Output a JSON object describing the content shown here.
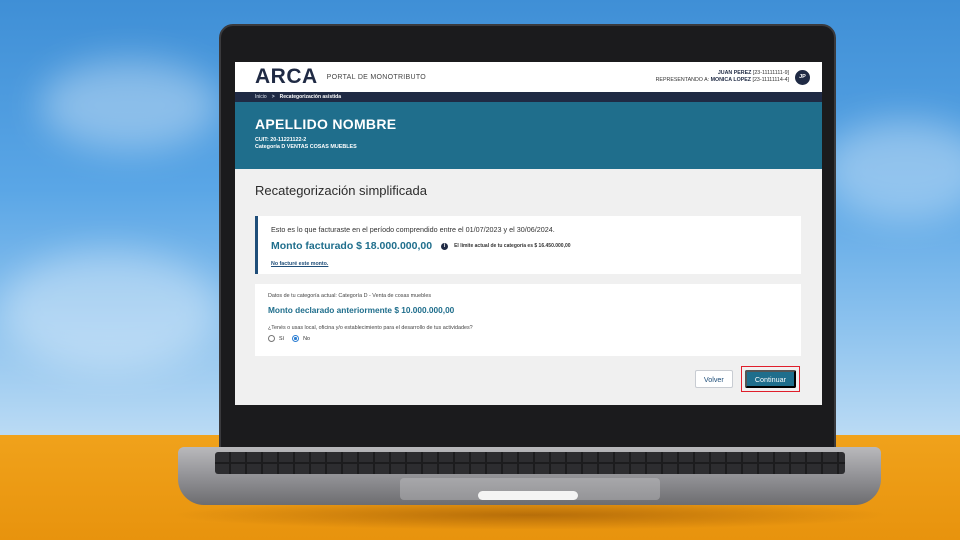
{
  "app": {
    "logo": "ARCA",
    "portal_name": "PORTAL DE MONOTRIBUTO"
  },
  "user": {
    "name": "JUAN PEREZ",
    "cuit": "[23-11111111-9]",
    "representing_label": "REPRESENTANDO A:",
    "represented_name": "MONICA LOPEZ",
    "represented_cuit": "[23-11111114-4]",
    "initials": "JP"
  },
  "breadcrumb": {
    "home": "Inicio",
    "separator": ">",
    "current": "Recategorización asistida"
  },
  "hero": {
    "title": "APELLIDO NOMBRE",
    "cuit": "CUIT: 20-11221122-2",
    "category": "Categoría D VENTAS COSAS MUEBLES"
  },
  "page": {
    "title": "Recategorización simplificada"
  },
  "billing_card": {
    "period_text": "Esto es lo que facturaste en el período comprendido entre el 01/07/2023 y el 30/06/2024.",
    "amount_text": "Monto facturado $ 18.000.000,00",
    "info_icon_glyph": "i",
    "limit_text": "El límite actual de tu categoría es $ 16.450.000,00",
    "link_text": "No facturé este monto."
  },
  "category_card": {
    "current_category_text": "Datos de tu categoría actual: Categoría D - Venta de cosas muebles",
    "declared_text": "Monto declarado anteriormente $ 10.000.000,00",
    "question": "¿Tenés o usas local, oficina y/o establecimiento para el desarrollo de tus actividades?",
    "options": [
      {
        "label": "Sí",
        "selected": false
      },
      {
        "label": "No",
        "selected": true
      }
    ]
  },
  "actions": {
    "back_label": "Volver",
    "continue_label": "Continuar",
    "highlight_color": "#e01e2b"
  },
  "colors": {
    "navy": "#1f2a44",
    "teal": "#1f6e8c",
    "desk": "#f0a21b",
    "sky": "#5aa6e6"
  }
}
